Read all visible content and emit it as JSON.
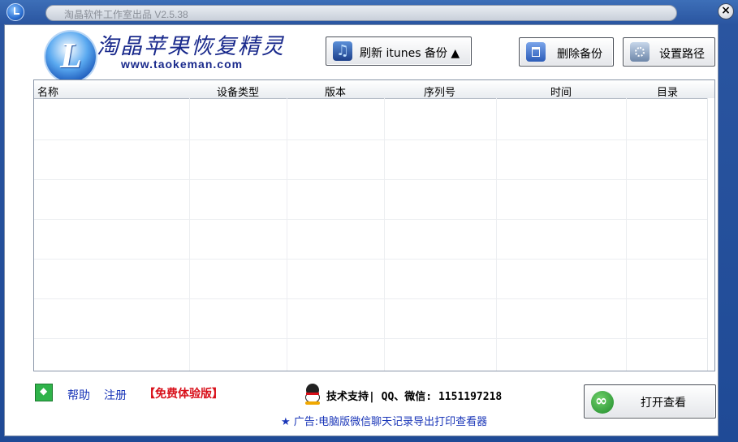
{
  "window": {
    "title": "淘晶软件工作室出品 V2.5.38",
    "close_symbol": "×"
  },
  "brand": {
    "logo_letter": "L",
    "app_name": "淘晶苹果恢复精灵",
    "url": "www.taokeman.com"
  },
  "toolbar": {
    "refresh_label": "刷新 itunes 备份 ▲",
    "delete_label": "删除备份",
    "set_path_label": "设置路径"
  },
  "table": {
    "columns": [
      "名称",
      "设备类型",
      "版本",
      "序列号",
      "时间",
      "目录"
    ],
    "rows": []
  },
  "footer": {
    "help_label": "帮助",
    "register_label": "注册",
    "trial_label": "【免费体验版】",
    "support_text": "技术支持| QQ、微信: 1151197218",
    "ad_text": "★ 广告:电脑版微信聊天记录导出打印查看器",
    "open_label": "打开查看"
  },
  "colors": {
    "frame": "#2a55a0",
    "link": "#1a36b8",
    "trial": "#d8101a",
    "brand": "#1a2a8c"
  },
  "icons": {
    "system": "clock-icon",
    "refresh": "music-note-icon",
    "delete": "trash-icon",
    "set_path": "folder-gear-icon",
    "help": "help-diamond-icon",
    "support": "qq-penguin-icon",
    "open": "open-view-icon"
  }
}
